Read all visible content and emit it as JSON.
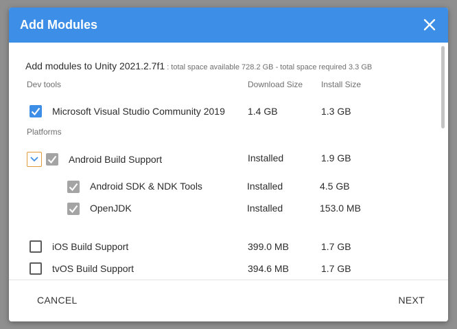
{
  "dialog": {
    "title": "Add Modules",
    "close_icon": "close-icon"
  },
  "summary": {
    "main": "Add modules to Unity 2021.2.7f1",
    "detail": " : total space available 728.2 GB - total space required 3.3 GB"
  },
  "columns": {
    "download": "Download Size",
    "install": "Install Size"
  },
  "sections": {
    "dev_tools": "Dev tools",
    "platforms": "Platforms"
  },
  "modules": {
    "vs": {
      "label": "Microsoft Visual Studio Community 2019",
      "download": "1.4 GB",
      "install": "1.3 GB",
      "checked": true
    },
    "android": {
      "label": "Android Build Support",
      "download": "Installed",
      "install": "1.9 GB",
      "checked": true,
      "expanded": true
    },
    "android_sdk": {
      "label": "Android SDK & NDK Tools",
      "download": "Installed",
      "install": "4.5 GB",
      "checked": true
    },
    "openjdk": {
      "label": "OpenJDK",
      "download": "Installed",
      "install": "153.0 MB",
      "checked": true
    },
    "ios": {
      "label": "iOS Build Support",
      "download": "399.0 MB",
      "install": "1.7 GB",
      "checked": false
    },
    "tvos": {
      "label": "tvOS Build Support",
      "download": "394.6 MB",
      "install": "1.7 GB",
      "checked": false
    }
  },
  "footer": {
    "cancel": "CANCEL",
    "next": "NEXT"
  },
  "colors": {
    "header": "#3d8ee6",
    "checked_blue": "#3d8ee6",
    "checked_gray": "#a4a4a4",
    "expander_border": "#e09a3a"
  }
}
